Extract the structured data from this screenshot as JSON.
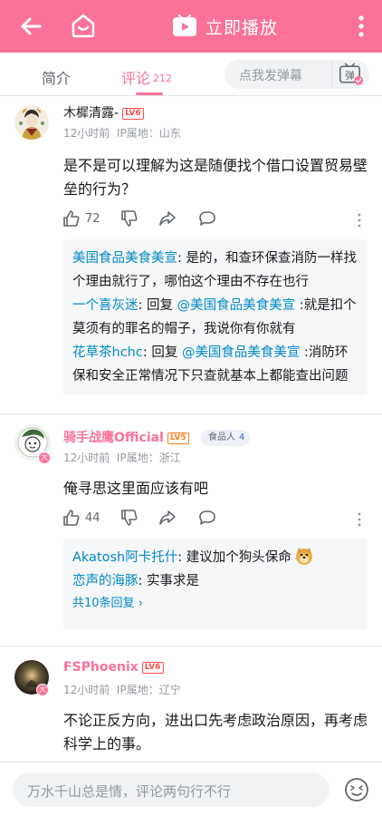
{
  "header": {
    "play_label": "立即播放",
    "bg_color": "#fb7299"
  },
  "tabs": {
    "intro": "简介",
    "comments": "评论",
    "comments_count": "212"
  },
  "danmaku": {
    "placeholder": "点我发弹幕",
    "icon_text": "弹"
  },
  "comments": [
    {
      "username": "木樨清露-",
      "level": "LV6",
      "time": "12小时前",
      "ip": "IP属地：山东",
      "content": "是不是可以理解为这是随便找个借口设置贸易壁垒的行为？",
      "likes": "72",
      "replies": [
        {
          "user": "美国食品美食美宣",
          "sep": ": ",
          "prefix": "",
          "at": "",
          "text": "是的，和查环保查消防一样找个理由就行了，哪怕这个理由不存在也行"
        },
        {
          "user": "一个喜灰迷",
          "sep": ": ",
          "prefix": "回复 ",
          "at": "@美国食品美食美宣",
          "text": " :就是扣个莫须有的罪名的帽子，我说你有你就有"
        },
        {
          "user": "花草茶hchc",
          "sep": ": ",
          "prefix": "回复 ",
          "at": "@美国食品美食美宣",
          "text": " :消防环保和安全正常情况下只查就基本上都能查出问题"
        }
      ]
    },
    {
      "username": "骑手战鹰Official",
      "level": "LV5",
      "badge": "食品人",
      "badge_num": "4",
      "time": "12小时前",
      "ip": "IP属地：浙江",
      "content": "俺寻思这里面应该有吧",
      "likes": "44",
      "replies": [
        {
          "user": "Akatosh阿卡托什",
          "sep": ": ",
          "text": "建议加个狗头保命"
        },
        {
          "user": "恋声的海豚",
          "sep": ": ",
          "text": "实事求是"
        }
      ],
      "more_replies": "共10条回复 ›"
    },
    {
      "username": "FSPhoenix",
      "level": "LV6",
      "time": "12小时前",
      "ip": "IP属地：辽宁",
      "content": "不论正反方向，进出口先考虑政治原因，再考虑科学上的事。"
    }
  ],
  "bottom": {
    "placeholder": "万水千山总是情，评论两句行不行"
  },
  "colors": {
    "accent": "#fb7299",
    "link": "#008ac5",
    "lv6": "#ff4d4d",
    "lv5": "#ff7f24"
  }
}
